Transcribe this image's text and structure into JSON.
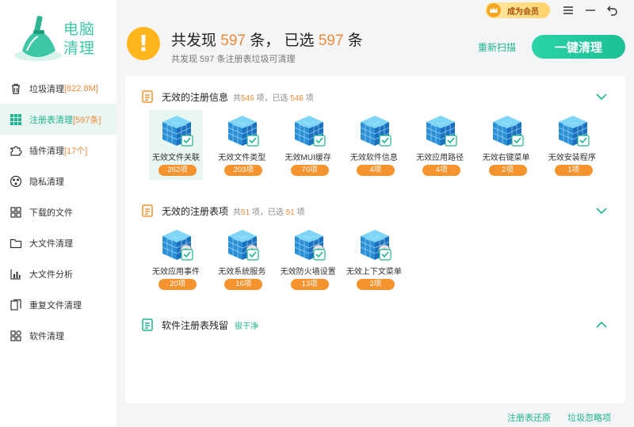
{
  "app": {
    "name_line1": "电脑",
    "name_line2": "清理"
  },
  "titlebar": {
    "vip_label": "成为会员"
  },
  "sidebar": {
    "items": [
      {
        "label": "垃圾清理",
        "count": "[822.8M]",
        "icon": "trash-icon",
        "active": false
      },
      {
        "label": "注册表清理",
        "count": "[597条]",
        "icon": "grid-icon",
        "active": true
      },
      {
        "label": "插件清理",
        "count": "[17个]",
        "icon": "puzzle-icon",
        "active": false
      },
      {
        "label": "隐私清理",
        "count": "",
        "icon": "privacy-icon",
        "active": false
      },
      {
        "label": "下载的文件",
        "count": "",
        "icon": "download-icon",
        "active": false
      },
      {
        "label": "大文件清理",
        "count": "",
        "icon": "folder-icon",
        "active": false
      },
      {
        "label": "大文件分析",
        "count": "",
        "icon": "bar-chart-icon",
        "active": false
      },
      {
        "label": "重复文件清理",
        "count": "",
        "icon": "duplicate-icon",
        "active": false
      },
      {
        "label": "软件清理",
        "count": "",
        "icon": "apps-icon",
        "active": false
      }
    ]
  },
  "header": {
    "title_prefix": "共发现 ",
    "title_found": "597",
    "title_mid": " 条，  已选 ",
    "title_selected": "597",
    "title_suffix": " 条",
    "subtitle": "共发现 597 条注册表垃圾可清理",
    "rescan_label": "重新扫描",
    "clean_label": "一键清理"
  },
  "sections": [
    {
      "title": "无效的注册信息",
      "stat_prefix": "共",
      "total": "546",
      "stat_mid": " 项，已选 ",
      "selected": "546",
      "stat_suffix": " 项",
      "expanded": true,
      "items": [
        {
          "label": "无效文件关联",
          "count": "262项"
        },
        {
          "label": "无效文件类型",
          "count": "203项"
        },
        {
          "label": "无效MUI缓存",
          "count": "70项"
        },
        {
          "label": "无效软件信息",
          "count": "4项"
        },
        {
          "label": "无效应用路径",
          "count": "4项"
        },
        {
          "label": "无效右键菜单",
          "count": "2项"
        },
        {
          "label": "无效安装程序",
          "count": "1项"
        }
      ]
    },
    {
      "title": "无效的注册表项",
      "stat_prefix": "共",
      "total": "51",
      "stat_mid": " 项，已选 ",
      "selected": "51",
      "stat_suffix": " 项",
      "expanded": true,
      "items": [
        {
          "label": "无效应用事件",
          "count": "20项"
        },
        {
          "label": "无效系统服务",
          "count": "16项"
        },
        {
          "label": "无效防火墙设置",
          "count": "13项"
        },
        {
          "label": "无效上下文菜单",
          "count": "2项"
        }
      ]
    },
    {
      "title": "软件注册表残留",
      "status": "很干净",
      "expanded": false
    }
  ],
  "footer": {
    "restore_label": "注册表还原",
    "ignore_label": "垃圾忽略项"
  },
  "colors": {
    "accent": "#1db58f",
    "highlight": "#f08a3a",
    "badge": "#f5942e",
    "warning": "#ffb61d"
  }
}
